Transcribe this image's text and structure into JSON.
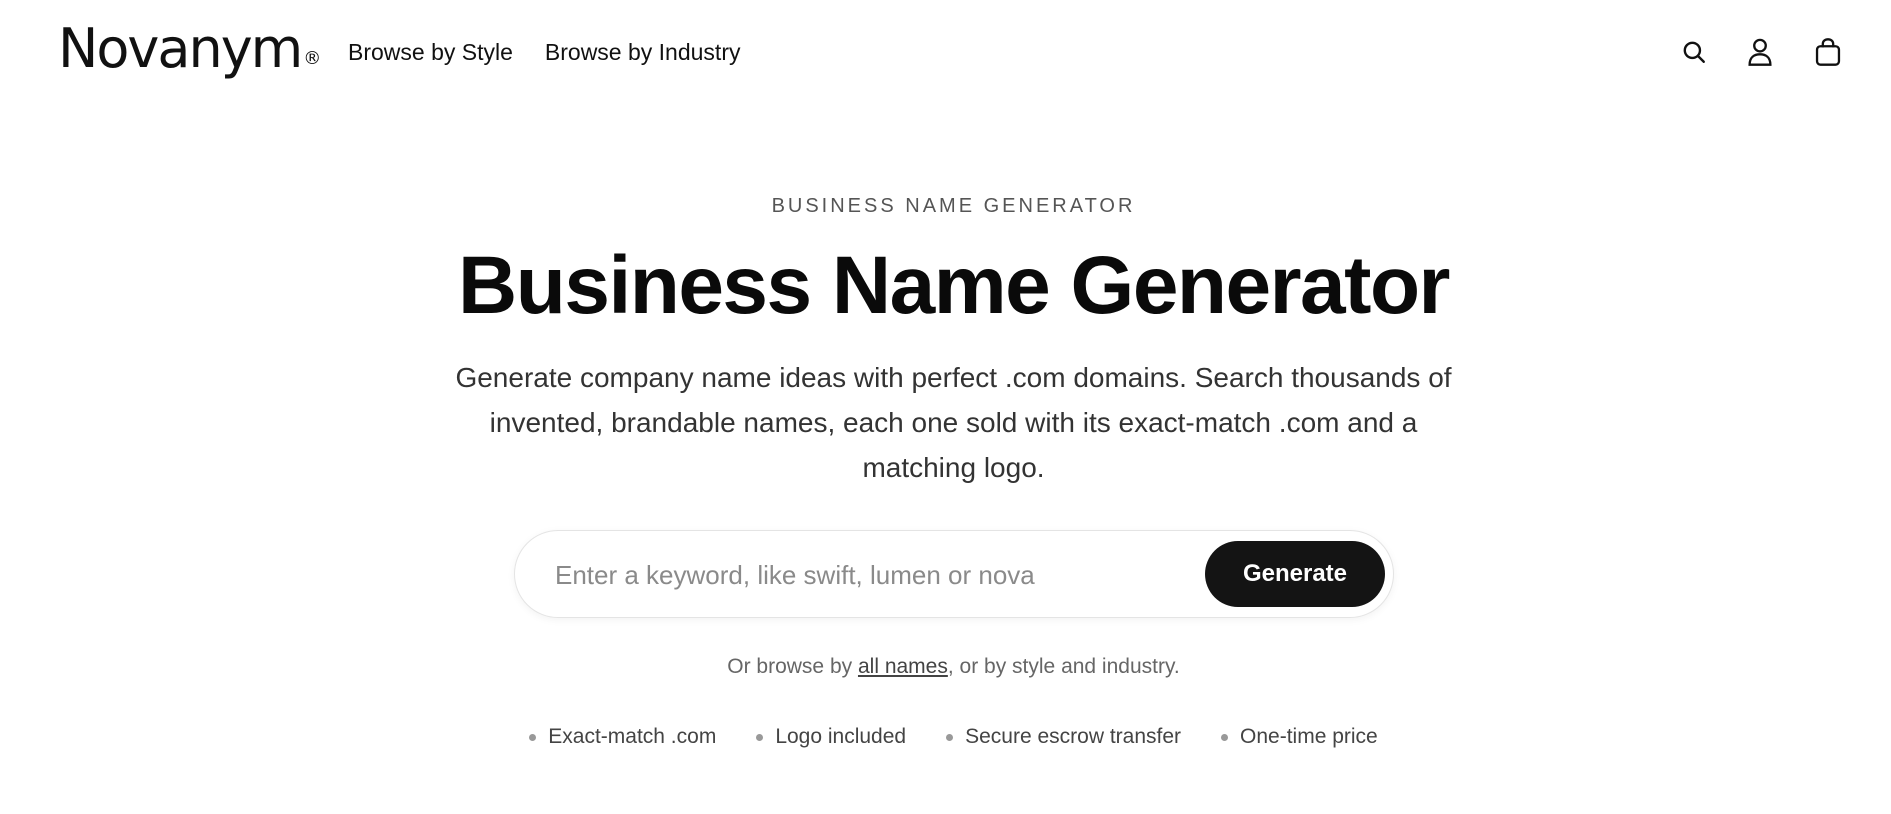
{
  "brand": {
    "name": "Novanym",
    "mark": "®"
  },
  "nav": {
    "items": [
      {
        "label": "Browse by Style"
      },
      {
        "label": "Browse by Industry"
      }
    ]
  },
  "header_icons": {
    "search": "search-icon",
    "account": "user-icon",
    "cart": "shopping-bag-icon"
  },
  "hero": {
    "eyebrow": "BUSINESS NAME GENERATOR",
    "title": "Business Name Generator",
    "subtitle": "Generate company name ideas with perfect .com domains. Search thousands of invented, brandable names, each one sold with its exact-match .com and a matching logo."
  },
  "search": {
    "value": "",
    "placeholder": "Enter a keyword, like swift, lumen or nova",
    "button_label": "Generate"
  },
  "browse": {
    "prefix": "Or browse by ",
    "link_label": "all names",
    "suffix": ", or by style and industry."
  },
  "features": [
    {
      "label": "Exact-match .com"
    },
    {
      "label": "Logo included"
    },
    {
      "label": "Secure escrow transfer"
    },
    {
      "label": "One-time price"
    }
  ],
  "colors": {
    "text": "#111111",
    "button_bg": "#141414",
    "button_text": "#ffffff",
    "muted": "#666666"
  }
}
